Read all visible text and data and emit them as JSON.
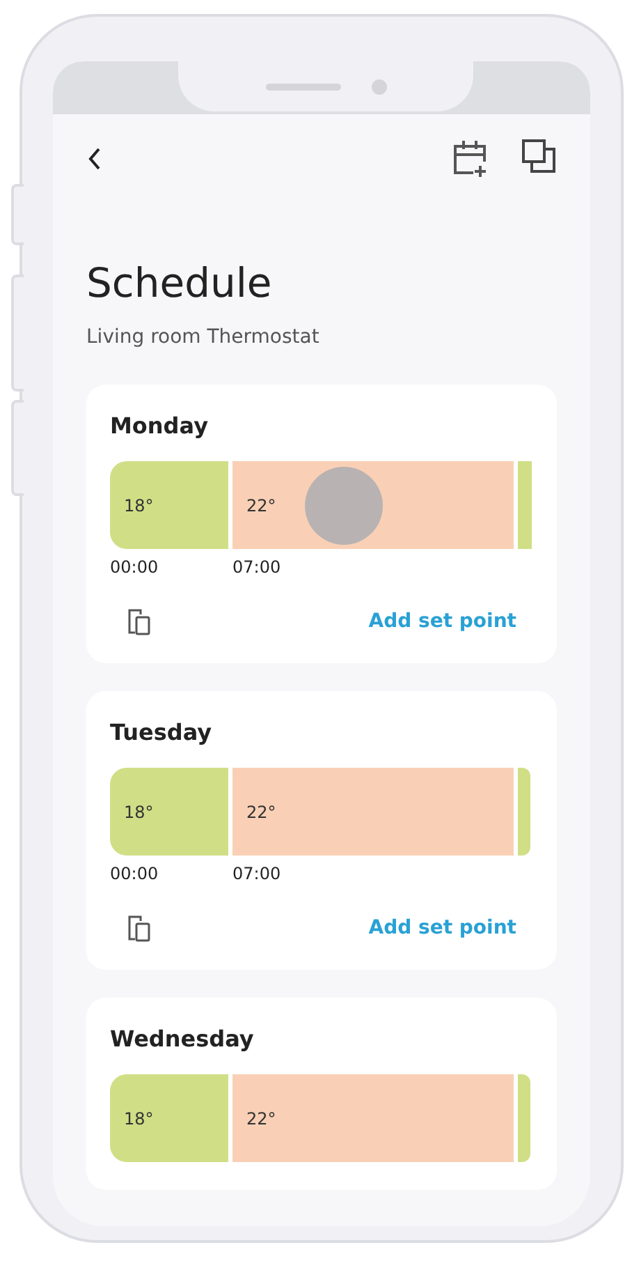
{
  "title": "Schedule",
  "subtitle": "Living room Thermostat",
  "days": [
    {
      "name": "Monday",
      "touch_indicator": true,
      "segments": [
        {
          "kind": "cool",
          "temp": "18°",
          "time": "00:00"
        },
        {
          "kind": "warm",
          "temp": "22°",
          "time": "07:00"
        },
        {
          "kind": "cool"
        }
      ],
      "action": "Add set point"
    },
    {
      "name": "Tuesday",
      "touch_indicator": false,
      "segments": [
        {
          "kind": "cool",
          "temp": "18°",
          "time": "00:00"
        },
        {
          "kind": "warm",
          "temp": "22°",
          "time": "07:00"
        },
        {
          "kind": "cool"
        }
      ],
      "action": "Add set point"
    },
    {
      "name": "Wednesday",
      "touch_indicator": false,
      "segments": [
        {
          "kind": "cool",
          "temp": "18°"
        },
        {
          "kind": "warm",
          "temp": "22°"
        },
        {
          "kind": "cool"
        }
      ]
    }
  ]
}
